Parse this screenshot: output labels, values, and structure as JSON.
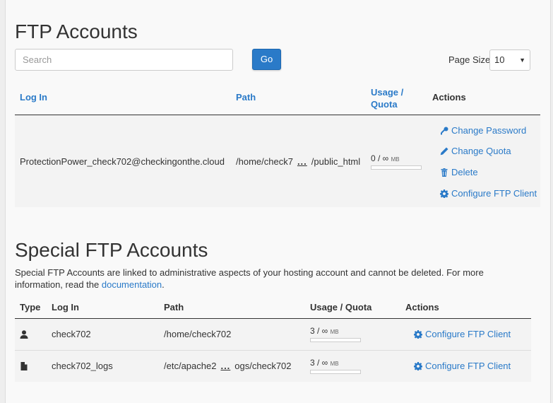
{
  "ftp": {
    "title": "FTP Accounts",
    "search_placeholder": "Search",
    "go_label": "Go",
    "page_size_label": "Page Size",
    "page_size_value": "10",
    "headers": {
      "login": "Log In",
      "path": "Path",
      "usage_a": "Usage /",
      "usage_b": "Quota",
      "actions": "Actions"
    },
    "rows": [
      {
        "login": "ProtectionPower_check702@checkingonthe.cloud",
        "path_start": "/home/check7",
        "path_ellipsis": "...",
        "path_end": "/public_html",
        "usage": "0 / ∞",
        "unit": "MB",
        "usage_fraction": 0,
        "actions": {
          "change_password": "Change Password",
          "change_quota": "Change Quota",
          "delete": "Delete",
          "configure": "Configure FTP Client"
        }
      }
    ]
  },
  "special": {
    "title": "Special FTP Accounts",
    "description_text": "Special FTP Accounts are linked to administrative aspects of your hosting account and cannot be deleted. For more information, read the ",
    "description_link": "documentation",
    "description_end": ".",
    "headers": {
      "type": "Type",
      "login": "Log In",
      "path": "Path",
      "usage": "Usage / Quota",
      "actions": "Actions"
    },
    "rows": [
      {
        "type_icon": "user-icon",
        "login": "check702",
        "path_start": "/home/check702",
        "path_ellipsis": "",
        "path_end": "",
        "usage": "3 / ∞",
        "unit": "MB",
        "configure": "Configure FTP Client"
      },
      {
        "type_icon": "file-icon",
        "login": "check702_logs",
        "path_start": "/etc/apache2",
        "path_ellipsis": "...",
        "path_end": "ogs/check702",
        "usage": "3 / ∞",
        "unit": "MB",
        "configure": "Configure FTP Client"
      }
    ]
  },
  "colors": {
    "accent": "#2a7ac8",
    "text": "#333333",
    "background": "#f9f9f9"
  }
}
